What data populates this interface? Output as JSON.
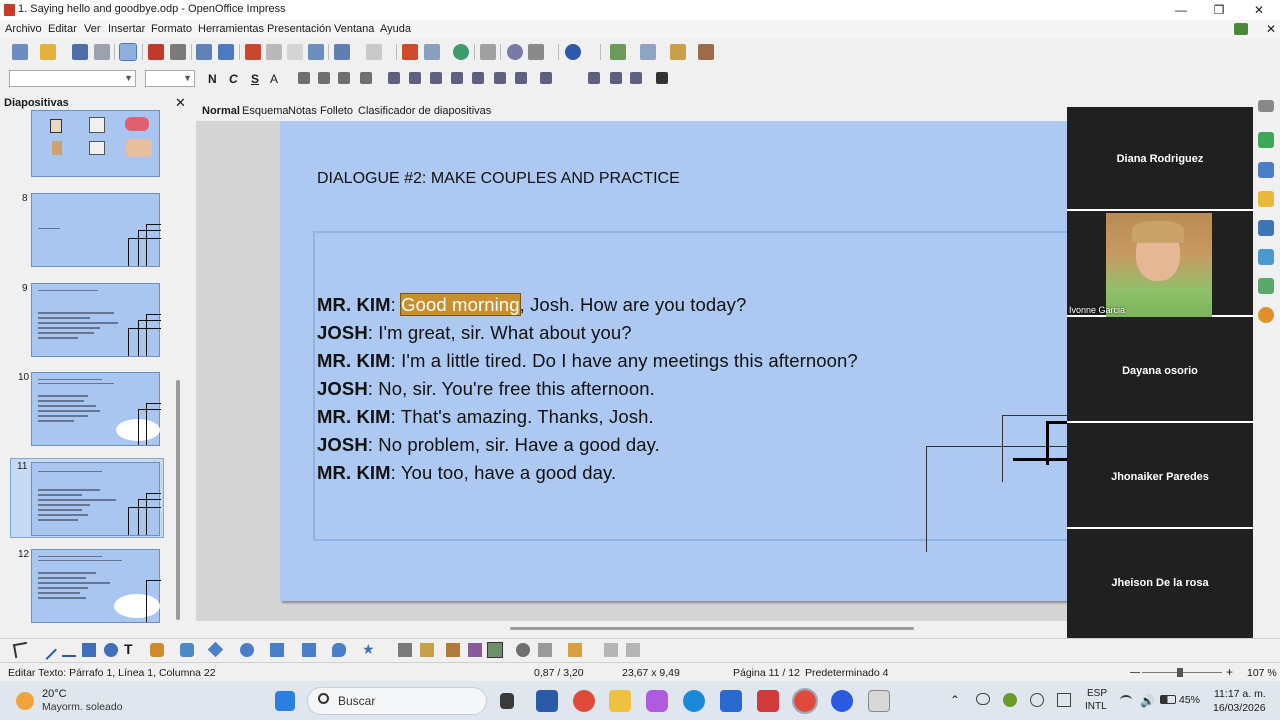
{
  "window": {
    "title": "1. Saying hello and goodbye.odp - OpenOffice Impress"
  },
  "menu": [
    "Archivo",
    "Editar",
    "Ver",
    "Insertar",
    "Formato",
    "Herramientas",
    "Presentación",
    "Ventana",
    "Ayuda"
  ],
  "slide_panel": {
    "title": "Diapositivas",
    "slides": [
      {
        "number": "8"
      },
      {
        "number": "9"
      },
      {
        "number": "10"
      },
      {
        "number": "11",
        "selected": true
      },
      {
        "number": "12"
      }
    ]
  },
  "view_tabs": [
    "Normal",
    "Esquema",
    "Notas",
    "Folleto",
    "Clasificador de diapositivas"
  ],
  "slide": {
    "heading": "DIALOGUE #2: MAKE COUPLES AND PRACTICE",
    "lines": [
      {
        "speaker": "MR. KIM",
        "pre": ": ",
        "highlight": "Good morning",
        "text": ", Josh. How are you today?"
      },
      {
        "speaker": "JOSH",
        "text": ": I'm great, sir. What about you?"
      },
      {
        "speaker": "MR. KIM",
        "text": ": I'm a little tired. Do I have any meetings this afternoon?"
      },
      {
        "speaker": "JOSH",
        "text": ": No, sir. You're free this afternoon."
      },
      {
        "speaker": "MR. KIM",
        "text": ": That's amazing. Thanks, Josh."
      },
      {
        "speaker": "JOSH",
        "text": ": No problem, sir. Have a good day."
      },
      {
        "speaker": "MR. KIM",
        "text": ": You too, have a good day."
      }
    ]
  },
  "participants": [
    {
      "name": "Diana Rodriguez"
    },
    {
      "name": "Ivonne Garcia",
      "video": true
    },
    {
      "name": "Dayana osorio"
    },
    {
      "name": "Jhonaiker Paredes"
    },
    {
      "name": "Jheison De la rosa"
    }
  ],
  "status": {
    "edit": "Editar Texto: Párrafo 1, Línea 1, Columna 22",
    "position": "0,87 / 3,20",
    "size": "23,67 x 9,49",
    "page": "Página 11 / 12",
    "layout": "Predeterminado 4",
    "zoom": "107 %"
  },
  "taskbar": {
    "weather_temp": "20°C",
    "weather_desc": "Mayorm. soleado",
    "search_placeholder": "Buscar",
    "lang": "ESP",
    "kbd": "INTL",
    "battery": "45%",
    "time": "11:17 a. m.",
    "date": "16/03/2026"
  },
  "colors": {
    "slide_bg": "#adc9f2",
    "highlight": "#c98e2e",
    "video_panel": "#202020"
  }
}
